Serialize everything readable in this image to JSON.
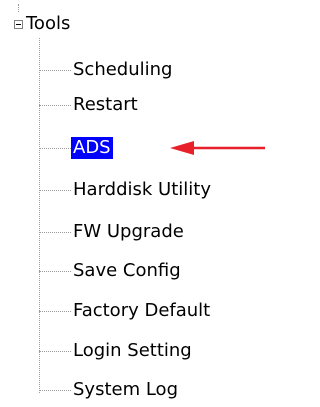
{
  "tree": {
    "root": {
      "label": "Tools",
      "expanded": true
    },
    "items": [
      {
        "label": "Scheduling",
        "selected": false
      },
      {
        "label": "Restart",
        "selected": false
      },
      {
        "label": "ADS",
        "selected": true
      },
      {
        "label": "Harddisk Utility",
        "selected": false
      },
      {
        "label": "FW Upgrade",
        "selected": false
      },
      {
        "label": "Save Config",
        "selected": false
      },
      {
        "label": "Factory Default",
        "selected": false
      },
      {
        "label": "Login Setting",
        "selected": false
      },
      {
        "label": "System Log",
        "selected": false
      }
    ]
  },
  "colors": {
    "selection_background": "#0000ff",
    "selection_text": "#ffffff",
    "arrow": "#e8202a",
    "connector": "#9a9a9a"
  },
  "annotation": {
    "icon": "red-arrow-icon",
    "points_to": "ADS"
  }
}
